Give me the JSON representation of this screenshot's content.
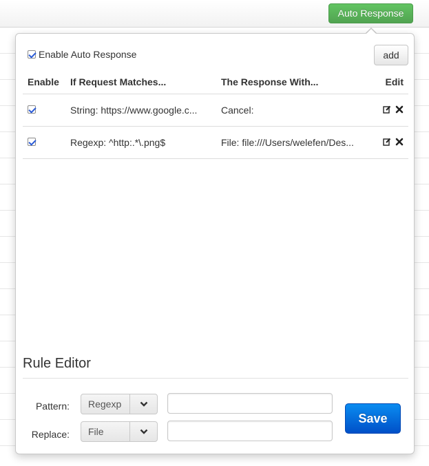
{
  "toolbar": {
    "auto_response_label": "Auto Response"
  },
  "popover": {
    "enable_label": "Enable Auto Response",
    "enable_checked": true,
    "add_label": "add",
    "columns": [
      "Enable",
      "If Request Matches...",
      "The Response With...",
      "Edit"
    ],
    "rules": [
      {
        "enabled": true,
        "match": "String: https://www.google.c...",
        "response": "Cancel:"
      },
      {
        "enabled": true,
        "match": "Regexp: ^http:.*\\.png$",
        "response": "File: file:///Users/welefen/Des..."
      }
    ],
    "icons": {
      "edit": "edit-icon",
      "delete": "delete-icon",
      "chevron": "chevron-down-icon"
    }
  },
  "editor": {
    "title": "Rule Editor",
    "pattern_label": "Pattern:",
    "pattern_type": "Regexp",
    "pattern_value": "",
    "replace_label": "Replace:",
    "replace_type": "File",
    "replace_value": "",
    "save_label": "Save"
  },
  "colors": {
    "auto_response": "#51a351",
    "save": "#0066d9"
  }
}
